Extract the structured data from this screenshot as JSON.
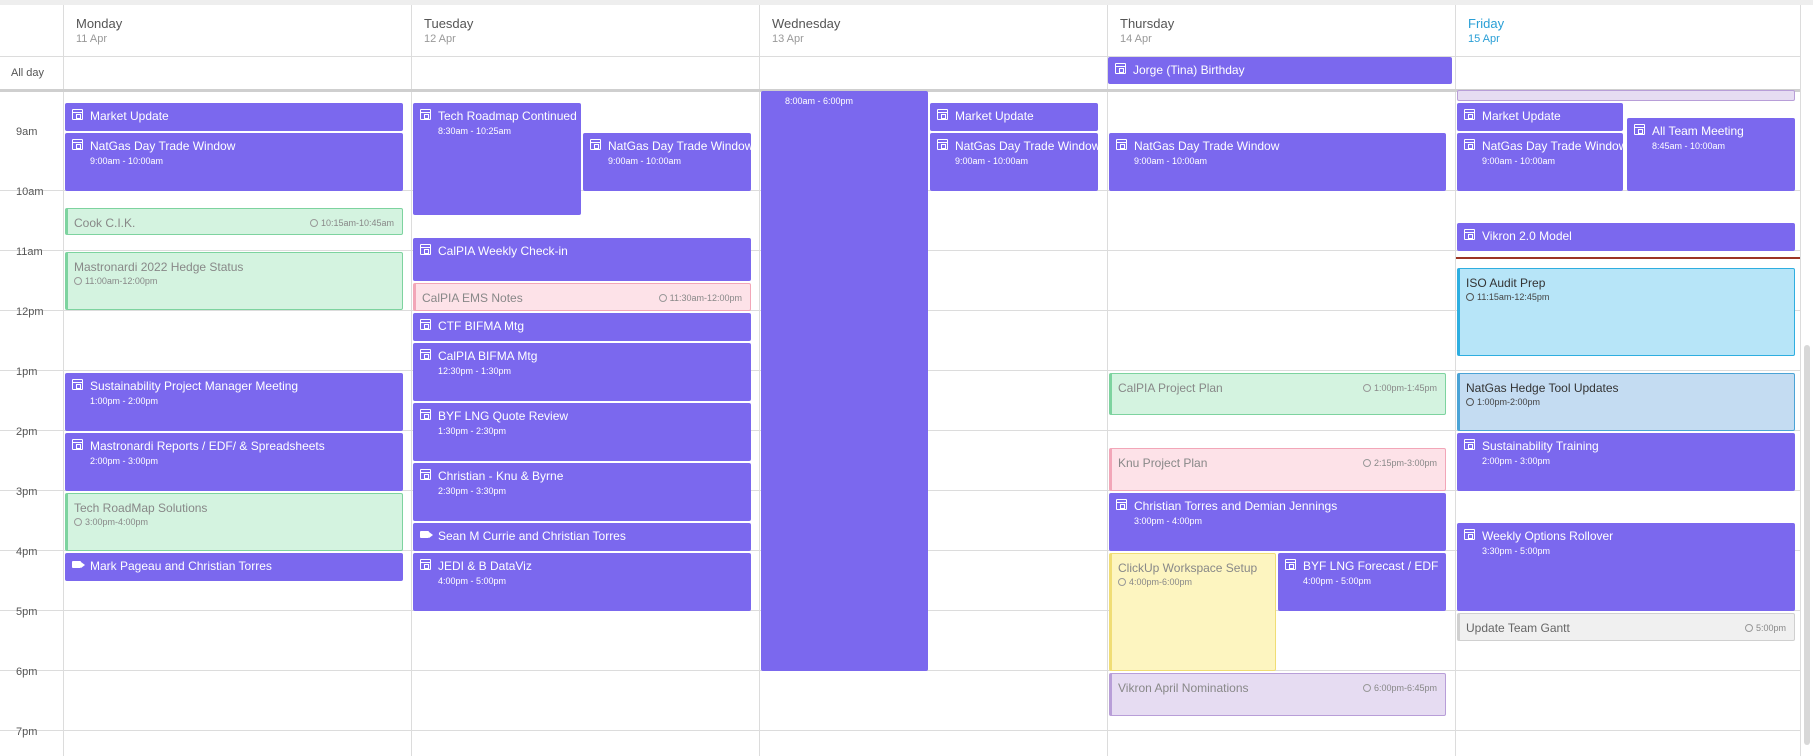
{
  "calendar": {
    "all_day_label": "All day",
    "hours": [
      "9am",
      "10am",
      "11am",
      "12pm",
      "1pm",
      "2pm",
      "3pm",
      "4pm",
      "5pm",
      "6pm",
      "7pm"
    ],
    "days": [
      {
        "name": "Monday",
        "date": "11 Apr",
        "today": false
      },
      {
        "name": "Tuesday",
        "date": "12 Apr",
        "today": false
      },
      {
        "name": "Wednesday",
        "date": "13 Apr",
        "today": false
      },
      {
        "name": "Thursday",
        "date": "14 Apr",
        "today": false
      },
      {
        "name": "Friday",
        "date": "15 Apr",
        "today": true
      }
    ],
    "all_day_events": [
      {
        "day": "Thursday",
        "title": "Jorge (Tina) Birthday",
        "icon": "calendar-icon"
      }
    ]
  },
  "colors": {
    "event_purple": "#7b68ee",
    "today_accent": "#2a9fd6",
    "now_line": "#9c3525"
  },
  "events": {
    "mon": [
      {
        "title": "Market Update",
        "time": "",
        "icon": "calendar-icon"
      },
      {
        "title": "NatGas Day Trade Window",
        "time": "9:00am - 10:00am",
        "icon": "calendar-icon"
      },
      {
        "title": "Cook C.I.K.",
        "time": "10:15am-10:45am"
      },
      {
        "title": "Mastronardi 2022 Hedge Status",
        "time": "11:00am-12:00pm"
      },
      {
        "title": "Sustainability Project Manager Meeting",
        "time": "1:00pm - 2:00pm",
        "icon": "calendar-icon"
      },
      {
        "title": "Mastronardi Reports / EDF/ & Spreadsheets",
        "time": "2:00pm - 3:00pm",
        "icon": "calendar-icon"
      },
      {
        "title": "Tech RoadMap Solutions",
        "time": "3:00pm-4:00pm"
      },
      {
        "title": "Mark Pageau and Christian Torres",
        "time": "",
        "icon": "video-icon"
      }
    ],
    "tue": [
      {
        "title": "Tech Roadmap Continued",
        "time": "8:30am - 10:25am",
        "icon": "calendar-icon"
      },
      {
        "title": "NatGas Day Trade Window",
        "time": "9:00am - 10:00am",
        "icon": "calendar-icon"
      },
      {
        "title": "CalPIA Weekly Check-in",
        "time": "",
        "icon": "calendar-icon"
      },
      {
        "title": "CalPIA EMS Notes",
        "time": "11:30am-12:00pm"
      },
      {
        "title": "CTF BIFMA Mtg",
        "time": "",
        "icon": "calendar-icon"
      },
      {
        "title": "CalPIA BIFMA Mtg",
        "time": "12:30pm - 1:30pm",
        "icon": "calendar-icon"
      },
      {
        "title": "BYF LNG Quote Review",
        "time": "1:30pm - 2:30pm",
        "icon": "calendar-icon"
      },
      {
        "title": "Christian - Knu & Byrne",
        "time": "2:30pm - 3:30pm",
        "icon": "calendar-icon"
      },
      {
        "title": "Sean M Currie and Christian Torres",
        "time": "",
        "icon": "video-icon"
      },
      {
        "title": "JEDI & B DataViz",
        "time": "4:00pm - 5:00pm",
        "icon": "calendar-icon"
      }
    ],
    "wed": [
      {
        "title": "",
        "time": "8:00am - 6:00pm"
      },
      {
        "title": "Market Update",
        "time": "",
        "icon": "calendar-icon"
      },
      {
        "title": "NatGas Day Trade Window",
        "time": "9:00am - 10:00am",
        "icon": "calendar-icon"
      }
    ],
    "thu": [
      {
        "title": "NatGas Day Trade Window",
        "time": "9:00am - 10:00am",
        "icon": "calendar-icon"
      },
      {
        "title": "CalPIA Project Plan",
        "time": "1:00pm-1:45pm"
      },
      {
        "title": "Knu Project Plan",
        "time": "2:15pm-3:00pm"
      },
      {
        "title": "Christian Torres and Demian Jennings",
        "time": "3:00pm - 4:00pm",
        "icon": "calendar-icon"
      },
      {
        "title": "ClickUp Workspace Setup",
        "time": "4:00pm-6:00pm"
      },
      {
        "title": "BYF LNG Forecast / EDF",
        "time": "4:00pm - 5:00pm",
        "icon": "calendar-icon"
      },
      {
        "title": "Vikron April Nominations",
        "time": "6:00pm-6:45pm"
      }
    ],
    "fri": [
      {
        "title": "",
        "time": ""
      },
      {
        "title": "Market Update",
        "time": "",
        "icon": "calendar-icon"
      },
      {
        "title": "All Team Meeting",
        "time": "8:45am - 10:00am",
        "icon": "calendar-icon"
      },
      {
        "title": "NatGas Day Trade Window",
        "time": "9:00am - 10:00am",
        "icon": "calendar-icon"
      },
      {
        "title": "Vikron 2.0 Model",
        "time": "",
        "icon": "calendar-icon"
      },
      {
        "title": "ISO Audit Prep",
        "time": "11:15am-12:45pm"
      },
      {
        "title": "NatGas Hedge Tool Updates",
        "time": "1:00pm-2:00pm"
      },
      {
        "title": "Sustainability Training",
        "time": "2:00pm - 3:00pm",
        "icon": "calendar-icon"
      },
      {
        "title": "Weekly Options Rollover",
        "time": "3:30pm - 5:00pm",
        "icon": "calendar-icon"
      },
      {
        "title": "Update Team Gantt",
        "time": "5:00pm"
      }
    ]
  }
}
